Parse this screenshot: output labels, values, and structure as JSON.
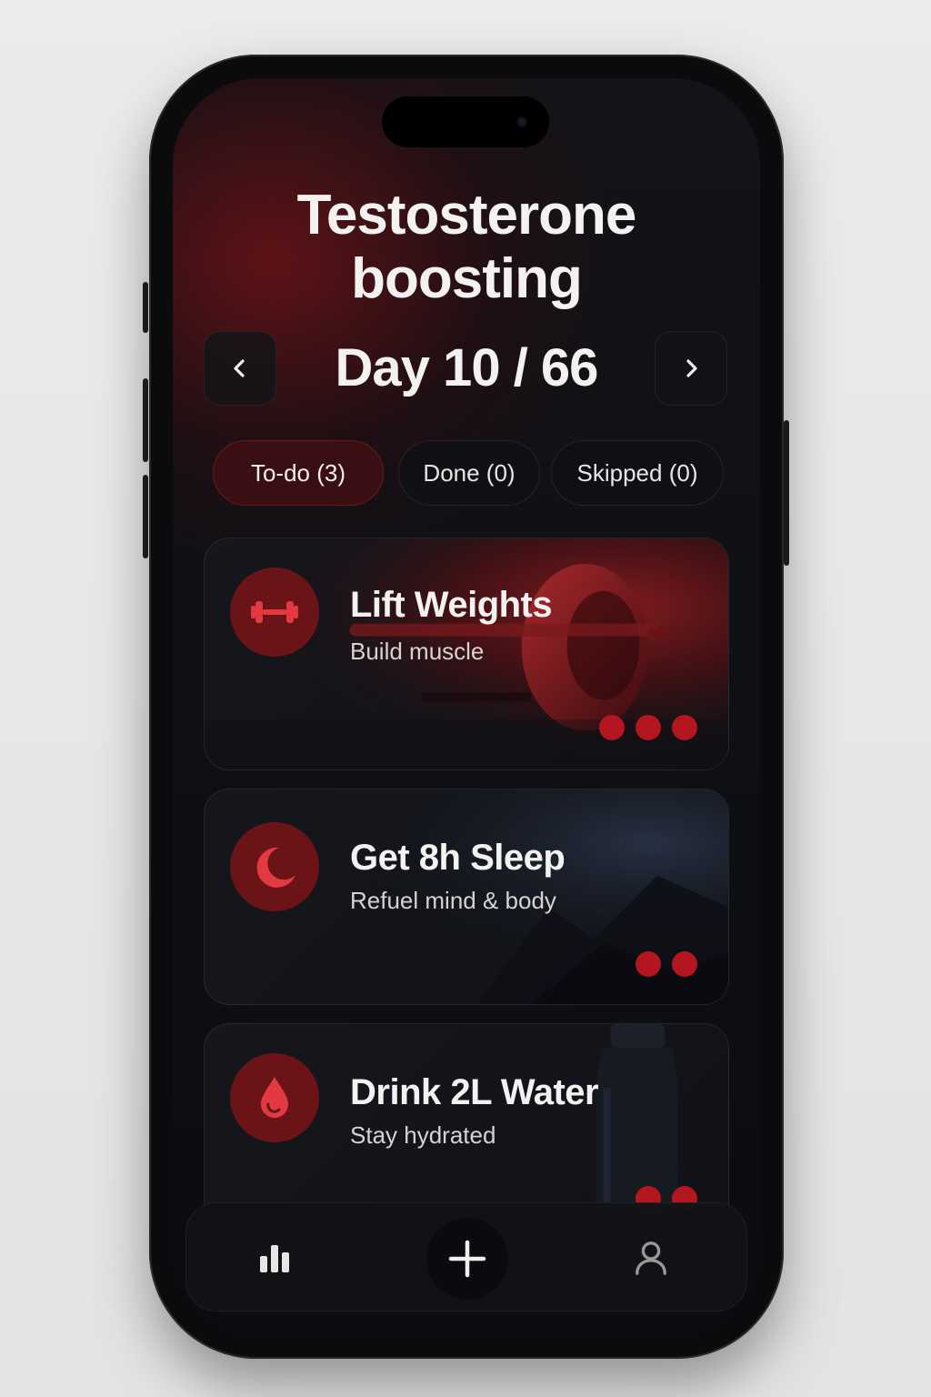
{
  "header": {
    "title_line1": "Testosterone",
    "title_line2": "boosting",
    "day_label": "Day 10 / 66"
  },
  "tabs": [
    {
      "label": "To-do (3)",
      "active": true
    },
    {
      "label": "Done (0)",
      "active": false
    },
    {
      "label": "Skipped (0)",
      "active": false
    }
  ],
  "tasks": [
    {
      "title": "Lift Weights",
      "subtitle": "Build muscle",
      "icon": "dumbbell-icon",
      "dots": 3
    },
    {
      "title": "Get 8h Sleep",
      "subtitle": "Refuel mind & body",
      "icon": "moon-icon",
      "dots": 2
    },
    {
      "title": "Drink 2L Water",
      "subtitle": "Stay hydrated",
      "icon": "water-drop-icon",
      "dots": 2
    }
  ],
  "bottom_nav": [
    {
      "icon": "bar-chart-icon"
    },
    {
      "icon": "plus-icon"
    },
    {
      "icon": "profile-icon"
    }
  ],
  "colors": {
    "accent": "#b3161f",
    "badge": "#6a1418",
    "active_tab": "#3a0f13",
    "background": "#0d0f13"
  }
}
